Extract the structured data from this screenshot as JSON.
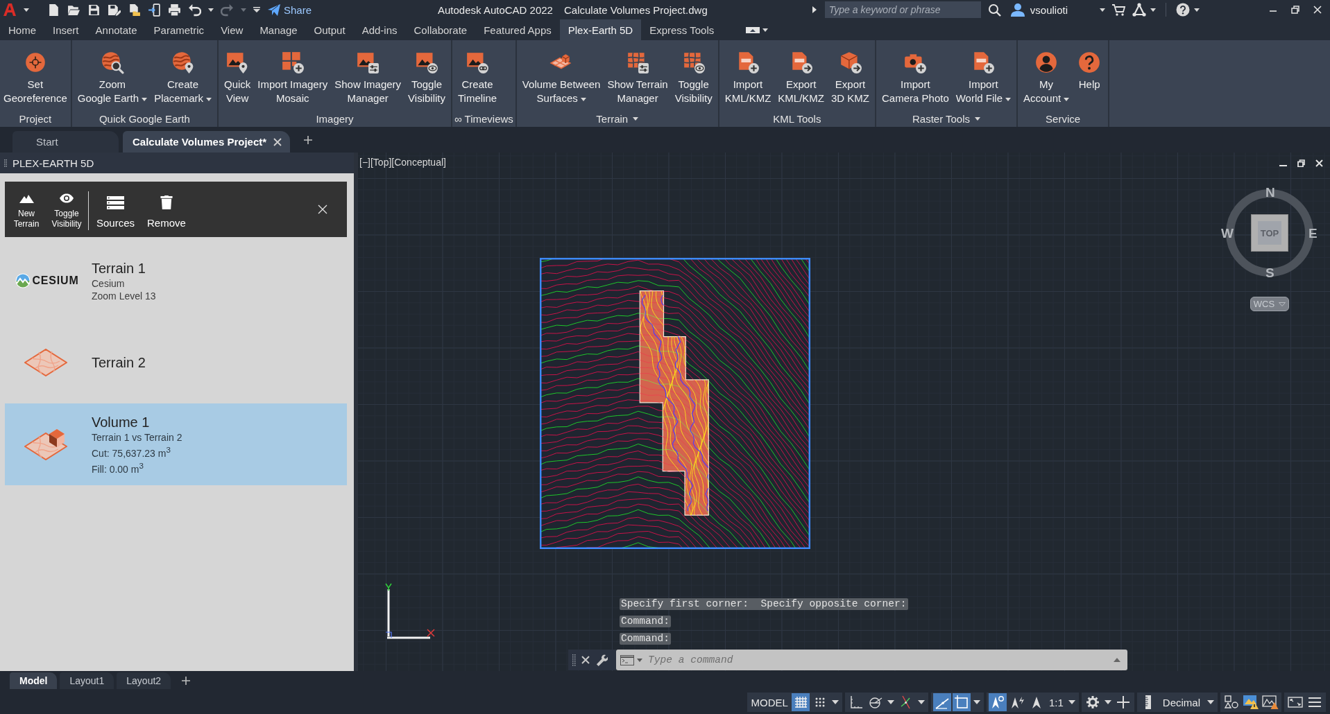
{
  "title_bar": {
    "quick_access": {
      "undo": {
        "disabled": false
      },
      "redo": {
        "disabled": true
      },
      "share": "Share"
    },
    "app_title": "Autodesk AutoCAD 2022",
    "document_title": "Calculate Volumes Project.dwg",
    "search": {
      "placeholder": "Type a keyword or phrase"
    },
    "user": "vsoulioti"
  },
  "ribbon": {
    "tabs": [
      {
        "label": "Home",
        "selected": false
      },
      {
        "label": "Insert",
        "selected": false
      },
      {
        "label": "Annotate",
        "selected": false
      },
      {
        "label": "Parametric",
        "selected": false
      },
      {
        "label": "View",
        "selected": false
      },
      {
        "label": "Manage",
        "selected": false
      },
      {
        "label": "Output",
        "selected": false
      },
      {
        "label": "Add-ins",
        "selected": false
      },
      {
        "label": "Collaborate",
        "selected": false
      },
      {
        "label": "Featured Apps",
        "selected": false
      },
      {
        "label": "Plex-Earth 5D",
        "selected": true
      },
      {
        "label": "Express Tools",
        "selected": false
      }
    ],
    "panels": [
      {
        "title": "Project",
        "dropdown": false,
        "buttons": [
          {
            "label": "Set\nGeoreference",
            "dropdown": false
          }
        ]
      },
      {
        "title": "Quick Google Earth",
        "dropdown": false,
        "buttons": [
          {
            "label": "Zoom\nGoogle Earth",
            "dropdown": true
          },
          {
            "label": "Create\nPlacemark",
            "dropdown": true
          }
        ]
      },
      {
        "title": "Imagery",
        "dropdown": false,
        "buttons": [
          {
            "label": "Quick\nView",
            "dropdown": false
          },
          {
            "label": "Import Imagery\nMosaic",
            "dropdown": false
          },
          {
            "label": "Show Imagery\nManager",
            "dropdown": false
          },
          {
            "label": "Toggle\nVisibility",
            "dropdown": false
          }
        ]
      },
      {
        "title": "∞ Timeviews",
        "dropdown": false,
        "buttons": [
          {
            "label": "Create\nTimeline",
            "dropdown": false
          }
        ]
      },
      {
        "title": "Terrain",
        "dropdown": true,
        "buttons": [
          {
            "label": "Volume Between\nSurfaces",
            "dropdown": true
          },
          {
            "label": "Show Terrain\nManager",
            "dropdown": false
          },
          {
            "label": "Toggle\nVisibility",
            "dropdown": false
          }
        ]
      },
      {
        "title": "KML Tools",
        "dropdown": false,
        "buttons": [
          {
            "label": "Import\nKML/KMZ",
            "dropdown": false
          },
          {
            "label": "Export\nKML/KMZ",
            "dropdown": false
          },
          {
            "label": "Export\n3D KMZ",
            "dropdown": false
          }
        ]
      },
      {
        "title": "Raster Tools",
        "dropdown": true,
        "buttons": [
          {
            "label": "Import\nCamera Photo",
            "dropdown": false
          },
          {
            "label": "Import\nWorld File",
            "dropdown": true
          }
        ]
      },
      {
        "title": "Service",
        "dropdown": false,
        "buttons": [
          {
            "label": "My\nAccount",
            "dropdown": true
          },
          {
            "label": "Help",
            "dropdown": false
          }
        ]
      }
    ]
  },
  "document_tabs": [
    {
      "label": "Start",
      "selected": false,
      "closable": false
    },
    {
      "label": "Calculate Volumes Project*",
      "selected": true,
      "closable": true
    }
  ],
  "palette": {
    "title": "PLEX-EARTH 5D",
    "toolbar": {
      "terrain_actions": [
        "New\nTerrain",
        "Toggle\nVisibility"
      ],
      "actions": [
        "Sources",
        "Remove"
      ]
    },
    "items": [
      {
        "kind": "logo",
        "logo_text": "CESIUM",
        "name": "Terrain 1",
        "details": [
          "Cesium",
          "Zoom Level 13"
        ],
        "selected": false
      },
      {
        "kind": "terrain",
        "name": "Terrain 2",
        "selected": false
      },
      {
        "kind": "volume",
        "name": "Volume 1",
        "details": [
          "Terrain 1 vs Terrain 2",
          "Cut: 75,637.23 m$^{3}$",
          "Fill: 0.00 m$^{3}$"
        ],
        "selected": true
      }
    ]
  },
  "viewport": {
    "controls": "[−][Top][Conceptual]",
    "viewcube": {
      "north": "N",
      "east": "E",
      "south": "S",
      "west": "W",
      "face": "TOP",
      "coordinate_system": "WCS"
    }
  },
  "command_line": {
    "history": [
      "Specify first corner:  Specify opposite corner:",
      "Command:",
      "Command:"
    ],
    "input": {
      "placeholder": "Type a command"
    }
  },
  "layout_tabs": [
    {
      "label": "Model",
      "selected": true
    },
    {
      "label": "Layout1",
      "selected": false
    },
    {
      "label": "Layout2",
      "selected": false
    }
  ],
  "status_bar": {
    "space": "MODEL",
    "toggles": [
      {
        "on": true
      },
      {
        "on": false
      },
      {
        "on": false
      },
      {
        "on": false
      },
      {
        "on": false
      },
      {
        "on": true
      },
      {
        "on": true
      },
      {
        "on": true
      },
      {
        "on": false
      },
      {
        "on": false
      }
    ],
    "annotation_scale": "1:1",
    "units": "Decimal"
  }
}
